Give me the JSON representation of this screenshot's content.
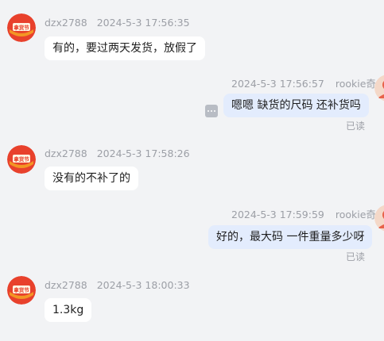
{
  "conversation": {
    "messages": [
      {
        "direction": "incoming",
        "sender": "dzx2788",
        "time": "2024-5-3 17:56:35",
        "text": "有的，要过两天发货，放假了",
        "avatar_badge": "拿货节"
      },
      {
        "direction": "outgoing",
        "sender": "rookie奇",
        "time": "2024-5-3 17:56:57",
        "text": "嗯嗯  缺货的尺码 还补货吗",
        "read_status": "已读"
      },
      {
        "direction": "incoming",
        "sender": "dzx2788",
        "time": "2024-5-3 17:58:26",
        "text": "没有的不补了的",
        "avatar_badge": "拿货节"
      },
      {
        "direction": "outgoing",
        "sender": "rookie奇",
        "time": "2024-5-3 17:59:59",
        "text": "好的，最大码 一件重量多少呀",
        "read_status": "已读"
      },
      {
        "direction": "incoming",
        "sender": "dzx2788",
        "time": "2024-5-3 18:00:33",
        "text": "1.3kg",
        "avatar_badge": "拿货节"
      }
    ]
  },
  "theme": {
    "background": "#f2f3f5",
    "incoming_bubble": "#ffffff",
    "outgoing_bubble": "#e3ecfd",
    "avatar_red": "#e8412c",
    "avatar_orange": "#f5a623",
    "meta_text": "#9c9fa6"
  },
  "icons": {
    "more": "more-icon",
    "avatar_seller": "shop-badge-avatar",
    "avatar_buyer": "user-avatar"
  }
}
